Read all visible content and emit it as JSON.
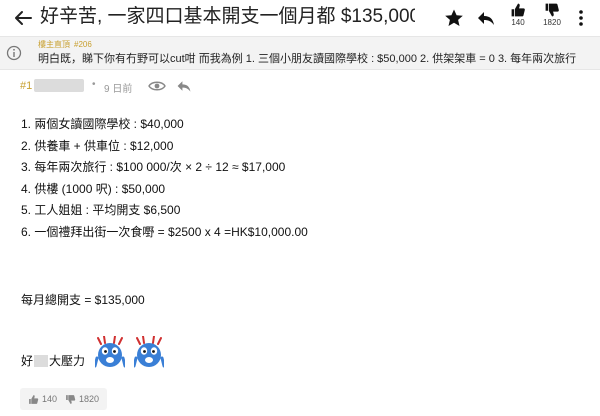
{
  "header": {
    "title": "好辛苦, 一家四口基本開支一個月都 $135,000, 完全儲...",
    "likes": "140",
    "dislikes": "1820"
  },
  "quote": {
    "label": "樓主直頂",
    "number": "#206",
    "text": "明白既，睇下你有冇野可以cut咁 而我為例 1. 三個小朋友讀國際學校 : $50,000 2. 供架架車 = 0 3. 每年兩次旅行"
  },
  "post": {
    "number": "#1",
    "dot": "•",
    "time": "9 日前",
    "lines": [
      "1. 兩個女讀國際學校 : $40,000",
      "2. 供養車 + 供車位 : $12,000",
      "3. 每年兩次旅行 : $100 000/次 × 2 ÷ 12 ≈ $17,000",
      "4. 供樓 (1000 呎) : $50,000",
      "5. 工人姐姐 : 平均開支 $6,500",
      "6. 一個禮拜出街一次食嘢 = $2500 x 4 =HK$10,000.00"
    ],
    "total": "每月總開支 = $135,000",
    "pressure_prefix": "好",
    "pressure_suffix": "大壓力"
  },
  "footer": {
    "likes": "140",
    "dislikes": "1820"
  },
  "colors": {
    "accent": "#c8a030",
    "muted": "#999999",
    "emoji_blue": "#3a7fd6"
  },
  "icons": [
    "back-arrow-icon",
    "star-icon",
    "reply-icon",
    "thumbs-up-icon",
    "thumbs-down-icon",
    "info-icon",
    "eye-icon",
    "panic-emoji-icon"
  ]
}
